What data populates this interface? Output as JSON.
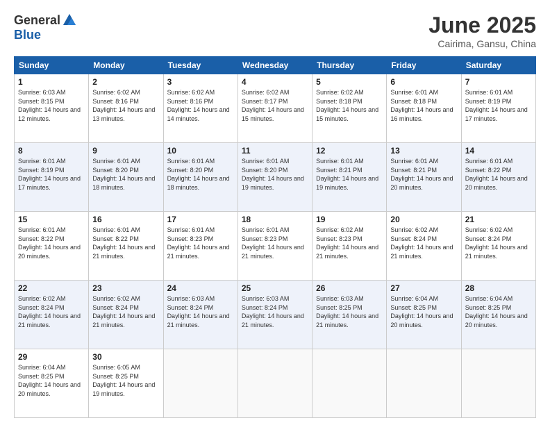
{
  "header": {
    "logo_general": "General",
    "logo_blue": "Blue",
    "title": "June 2025",
    "location": "Cairima, Gansu, China"
  },
  "weekdays": [
    "Sunday",
    "Monday",
    "Tuesday",
    "Wednesday",
    "Thursday",
    "Friday",
    "Saturday"
  ],
  "weeks": [
    [
      {
        "day": "1",
        "sunrise": "6:03 AM",
        "sunset": "8:15 PM",
        "daylight": "14 hours and 12 minutes."
      },
      {
        "day": "2",
        "sunrise": "6:02 AM",
        "sunset": "8:16 PM",
        "daylight": "14 hours and 13 minutes."
      },
      {
        "day": "3",
        "sunrise": "6:02 AM",
        "sunset": "8:16 PM",
        "daylight": "14 hours and 14 minutes."
      },
      {
        "day": "4",
        "sunrise": "6:02 AM",
        "sunset": "8:17 PM",
        "daylight": "14 hours and 15 minutes."
      },
      {
        "day": "5",
        "sunrise": "6:02 AM",
        "sunset": "8:18 PM",
        "daylight": "14 hours and 15 minutes."
      },
      {
        "day": "6",
        "sunrise": "6:01 AM",
        "sunset": "8:18 PM",
        "daylight": "14 hours and 16 minutes."
      },
      {
        "day": "7",
        "sunrise": "6:01 AM",
        "sunset": "8:19 PM",
        "daylight": "14 hours and 17 minutes."
      }
    ],
    [
      {
        "day": "8",
        "sunrise": "6:01 AM",
        "sunset": "8:19 PM",
        "daylight": "14 hours and 17 minutes."
      },
      {
        "day": "9",
        "sunrise": "6:01 AM",
        "sunset": "8:20 PM",
        "daylight": "14 hours and 18 minutes."
      },
      {
        "day": "10",
        "sunrise": "6:01 AM",
        "sunset": "8:20 PM",
        "daylight": "14 hours and 18 minutes."
      },
      {
        "day": "11",
        "sunrise": "6:01 AM",
        "sunset": "8:20 PM",
        "daylight": "14 hours and 19 minutes."
      },
      {
        "day": "12",
        "sunrise": "6:01 AM",
        "sunset": "8:21 PM",
        "daylight": "14 hours and 19 minutes."
      },
      {
        "day": "13",
        "sunrise": "6:01 AM",
        "sunset": "8:21 PM",
        "daylight": "14 hours and 20 minutes."
      },
      {
        "day": "14",
        "sunrise": "6:01 AM",
        "sunset": "8:22 PM",
        "daylight": "14 hours and 20 minutes."
      }
    ],
    [
      {
        "day": "15",
        "sunrise": "6:01 AM",
        "sunset": "8:22 PM",
        "daylight": "14 hours and 20 minutes."
      },
      {
        "day": "16",
        "sunrise": "6:01 AM",
        "sunset": "8:22 PM",
        "daylight": "14 hours and 21 minutes."
      },
      {
        "day": "17",
        "sunrise": "6:01 AM",
        "sunset": "8:23 PM",
        "daylight": "14 hours and 21 minutes."
      },
      {
        "day": "18",
        "sunrise": "6:01 AM",
        "sunset": "8:23 PM",
        "daylight": "14 hours and 21 minutes."
      },
      {
        "day": "19",
        "sunrise": "6:02 AM",
        "sunset": "8:23 PM",
        "daylight": "14 hours and 21 minutes."
      },
      {
        "day": "20",
        "sunrise": "6:02 AM",
        "sunset": "8:24 PM",
        "daylight": "14 hours and 21 minutes."
      },
      {
        "day": "21",
        "sunrise": "6:02 AM",
        "sunset": "8:24 PM",
        "daylight": "14 hours and 21 minutes."
      }
    ],
    [
      {
        "day": "22",
        "sunrise": "6:02 AM",
        "sunset": "8:24 PM",
        "daylight": "14 hours and 21 minutes."
      },
      {
        "day": "23",
        "sunrise": "6:02 AM",
        "sunset": "8:24 PM",
        "daylight": "14 hours and 21 minutes."
      },
      {
        "day": "24",
        "sunrise": "6:03 AM",
        "sunset": "8:24 PM",
        "daylight": "14 hours and 21 minutes."
      },
      {
        "day": "25",
        "sunrise": "6:03 AM",
        "sunset": "8:24 PM",
        "daylight": "14 hours and 21 minutes."
      },
      {
        "day": "26",
        "sunrise": "6:03 AM",
        "sunset": "8:25 PM",
        "daylight": "14 hours and 21 minutes."
      },
      {
        "day": "27",
        "sunrise": "6:04 AM",
        "sunset": "8:25 PM",
        "daylight": "14 hours and 20 minutes."
      },
      {
        "day": "28",
        "sunrise": "6:04 AM",
        "sunset": "8:25 PM",
        "daylight": "14 hours and 20 minutes."
      }
    ],
    [
      {
        "day": "29",
        "sunrise": "6:04 AM",
        "sunset": "8:25 PM",
        "daylight": "14 hours and 20 minutes."
      },
      {
        "day": "30",
        "sunrise": "6:05 AM",
        "sunset": "8:25 PM",
        "daylight": "14 hours and 19 minutes."
      },
      null,
      null,
      null,
      null,
      null
    ]
  ]
}
